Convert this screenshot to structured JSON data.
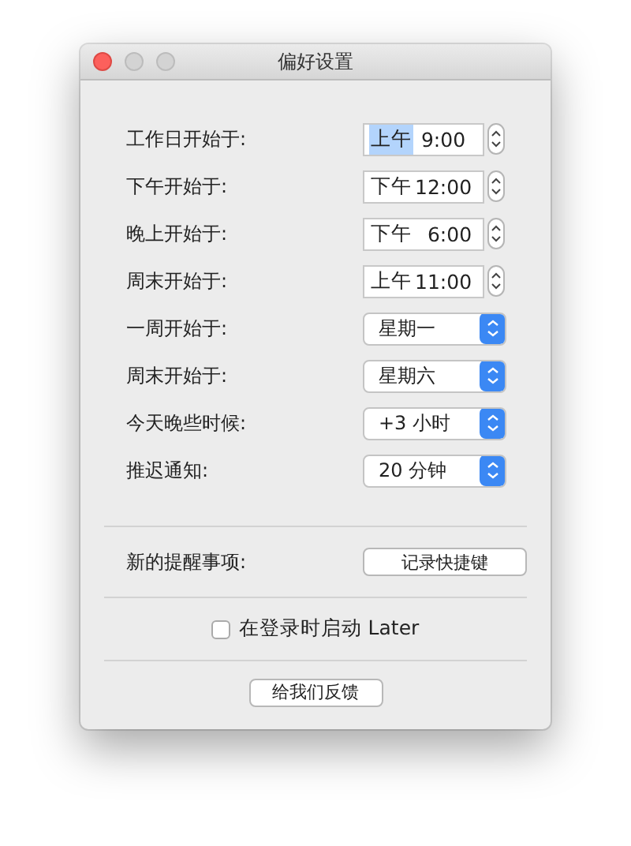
{
  "window": {
    "title": "偏好设置"
  },
  "settings": [
    {
      "label": "工作日开始于:",
      "kind": "time",
      "segments": [
        {
          "text": "上午",
          "selected": true
        },
        {
          "text": " 9:00",
          "selected": false
        }
      ]
    },
    {
      "label": "下午开始于:",
      "kind": "time",
      "segments": [
        {
          "text": "下午",
          "selected": false
        },
        {
          "text": "12:00",
          "selected": false
        }
      ]
    },
    {
      "label": "晚上开始于:",
      "kind": "time",
      "segments": [
        {
          "text": "下午",
          "selected": false
        },
        {
          "text": "  6:00",
          "selected": false
        }
      ]
    },
    {
      "label": "周末开始于:",
      "kind": "time",
      "segments": [
        {
          "text": "上午",
          "selected": false
        },
        {
          "text": "11:00",
          "selected": false
        }
      ]
    },
    {
      "label": "一周开始于:",
      "kind": "popup",
      "value": "星期一"
    },
    {
      "label": "周末开始于:",
      "kind": "popup",
      "value": "星期六"
    },
    {
      "label": "今天晚些时候:",
      "kind": "popup",
      "value": "+3 小时"
    },
    {
      "label": "推迟通知:",
      "kind": "popup",
      "value": "20 分钟"
    }
  ],
  "shortcut": {
    "label": "新的提醒事项:",
    "button": "记录快捷键"
  },
  "launch_at_login": {
    "label": "在登录时启动 Later",
    "checked": false
  },
  "feedback_button": "给我们反馈"
}
